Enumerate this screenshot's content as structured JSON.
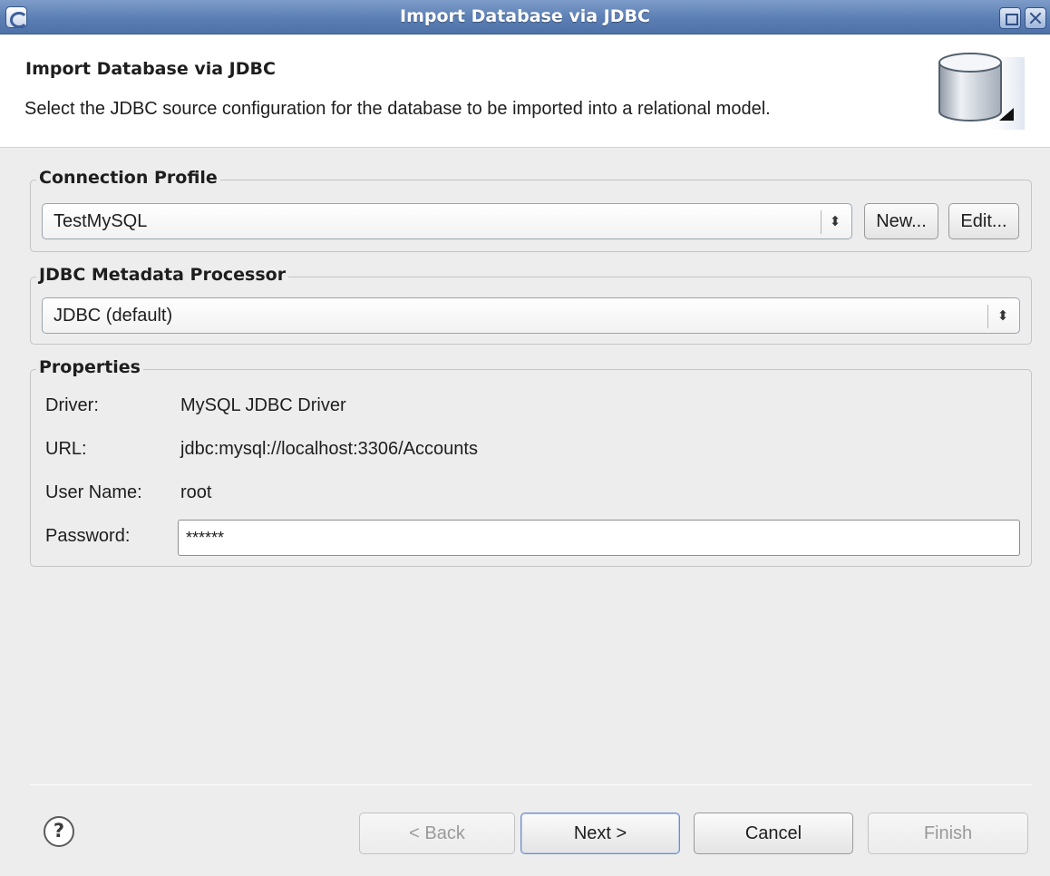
{
  "window": {
    "title": "Import Database via JDBC"
  },
  "header": {
    "title": "Import Database via JDBC",
    "description": "Select the JDBC source configuration for the database to be imported into a relational model.",
    "icon": "database-icon"
  },
  "connection_profile": {
    "label": "Connection Profile",
    "selected": "TestMySQL",
    "new_label": "New...",
    "edit_label": "Edit..."
  },
  "jdbc_processor": {
    "label": "JDBC Metadata Processor",
    "selected": "JDBC (default)"
  },
  "properties": {
    "label": "Properties",
    "driver_label": "Driver:",
    "driver_value": "MySQL JDBC Driver",
    "url_label": "URL:",
    "url_value": "jdbc:mysql://localhost:3306/Accounts",
    "user_label": "User Name:",
    "user_value": "root",
    "password_label": "Password:",
    "password_value": "******"
  },
  "footer": {
    "help_icon": "help-icon",
    "back_label": "< Back",
    "next_label": "Next >",
    "cancel_label": "Cancel",
    "finish_label": "Finish"
  },
  "colors": {
    "titlebar": "#5b7fb4",
    "background": "#ededed",
    "header_bg": "#ffffff"
  }
}
